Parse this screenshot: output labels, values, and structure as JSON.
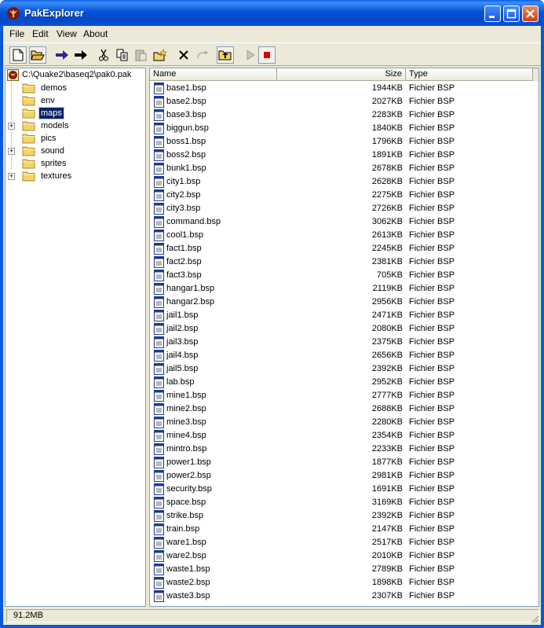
{
  "window": {
    "title": "PakExplorer"
  },
  "menu": [
    "File",
    "Edit",
    "View",
    "About"
  ],
  "toolbar": {
    "buttons": [
      "new-file-icon",
      "open-folder-icon",
      "arrow-right-purple-icon",
      "arrow-right-black-icon",
      "cut-icon",
      "copy-icon",
      "paste-icon",
      "new-folder-icon",
      "delete-icon",
      "redo-icon",
      "folder-up-icon",
      "play-icon",
      "stop-icon"
    ]
  },
  "tree": {
    "root": "C:\\Quake2\\baseq2\\pak0.pak",
    "nodes": [
      {
        "label": "demos",
        "expandable": false,
        "selected": false
      },
      {
        "label": "env",
        "expandable": false,
        "selected": false
      },
      {
        "label": "maps",
        "expandable": false,
        "selected": true
      },
      {
        "label": "models",
        "expandable": true,
        "selected": false
      },
      {
        "label": "pics",
        "expandable": false,
        "selected": false
      },
      {
        "label": "sound",
        "expandable": true,
        "selected": false
      },
      {
        "label": "sprites",
        "expandable": false,
        "selected": false
      },
      {
        "label": "textures",
        "expandable": true,
        "selected": false
      }
    ]
  },
  "list": {
    "columns": [
      "Name",
      "Size",
      "Type"
    ],
    "rows": [
      [
        "base1.bsp",
        "1944KB",
        "Fichier BSP"
      ],
      [
        "base2.bsp",
        "2027KB",
        "Fichier BSP"
      ],
      [
        "base3.bsp",
        "2283KB",
        "Fichier BSP"
      ],
      [
        "biggun.bsp",
        "1840KB",
        "Fichier BSP"
      ],
      [
        "boss1.bsp",
        "1796KB",
        "Fichier BSP"
      ],
      [
        "boss2.bsp",
        "1891KB",
        "Fichier BSP"
      ],
      [
        "bunk1.bsp",
        "2678KB",
        "Fichier BSP"
      ],
      [
        "city1.bsp",
        "2628KB",
        "Fichier BSP"
      ],
      [
        "city2.bsp",
        "2275KB",
        "Fichier BSP"
      ],
      [
        "city3.bsp",
        "2726KB",
        "Fichier BSP"
      ],
      [
        "command.bsp",
        "3062KB",
        "Fichier BSP"
      ],
      [
        "cool1.bsp",
        "2613KB",
        "Fichier BSP"
      ],
      [
        "fact1.bsp",
        "2245KB",
        "Fichier BSP"
      ],
      [
        "fact2.bsp",
        "2381KB",
        "Fichier BSP"
      ],
      [
        "fact3.bsp",
        "705KB",
        "Fichier BSP"
      ],
      [
        "hangar1.bsp",
        "2119KB",
        "Fichier BSP"
      ],
      [
        "hangar2.bsp",
        "2956KB",
        "Fichier BSP"
      ],
      [
        "jail1.bsp",
        "2471KB",
        "Fichier BSP"
      ],
      [
        "jail2.bsp",
        "2080KB",
        "Fichier BSP"
      ],
      [
        "jail3.bsp",
        "2375KB",
        "Fichier BSP"
      ],
      [
        "jail4.bsp",
        "2656KB",
        "Fichier BSP"
      ],
      [
        "jail5.bsp",
        "2392KB",
        "Fichier BSP"
      ],
      [
        "lab.bsp",
        "2952KB",
        "Fichier BSP"
      ],
      [
        "mine1.bsp",
        "2777KB",
        "Fichier BSP"
      ],
      [
        "mine2.bsp",
        "2688KB",
        "Fichier BSP"
      ],
      [
        "mine3.bsp",
        "2280KB",
        "Fichier BSP"
      ],
      [
        "mine4.bsp",
        "2354KB",
        "Fichier BSP"
      ],
      [
        "mintro.bsp",
        "2233KB",
        "Fichier BSP"
      ],
      [
        "power1.bsp",
        "1877KB",
        "Fichier BSP"
      ],
      [
        "power2.bsp",
        "2981KB",
        "Fichier BSP"
      ],
      [
        "security.bsp",
        "1691KB",
        "Fichier BSP"
      ],
      [
        "space.bsp",
        "3169KB",
        "Fichier BSP"
      ],
      [
        "strike.bsp",
        "2392KB",
        "Fichier BSP"
      ],
      [
        "train.bsp",
        "2147KB",
        "Fichier BSP"
      ],
      [
        "ware1.bsp",
        "2517KB",
        "Fichier BSP"
      ],
      [
        "ware2.bsp",
        "2010KB",
        "Fichier BSP"
      ],
      [
        "waste1.bsp",
        "2789KB",
        "Fichier BSP"
      ],
      [
        "waste2.bsp",
        "1898KB",
        "Fichier BSP"
      ],
      [
        "waste3.bsp",
        "2307KB",
        "Fichier BSP"
      ]
    ]
  },
  "status": {
    "text": "91.2MB"
  },
  "colors": {
    "titlebar": "#0553d6",
    "selection": "#0a246a",
    "folder": "#f3d36b",
    "stop": "#e00000"
  }
}
